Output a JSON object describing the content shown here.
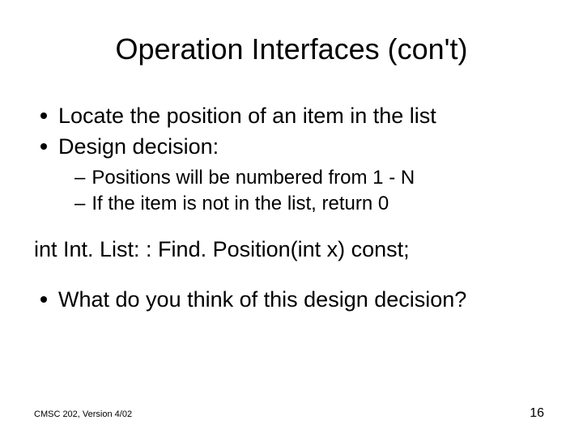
{
  "title": "Operation Interfaces (con't)",
  "bullets": {
    "b1": "Locate the position of an item in the list",
    "b2": "Design decision:",
    "s1": "Positions will be numbered from 1 - N",
    "s2": "If the item is not in the list, return 0",
    "b3": "What do you think of this design decision?"
  },
  "code": "int Int. List: : Find. Position(int x) const;",
  "footer": {
    "left": "CMSC 202, Version 4/02",
    "right": "16"
  }
}
